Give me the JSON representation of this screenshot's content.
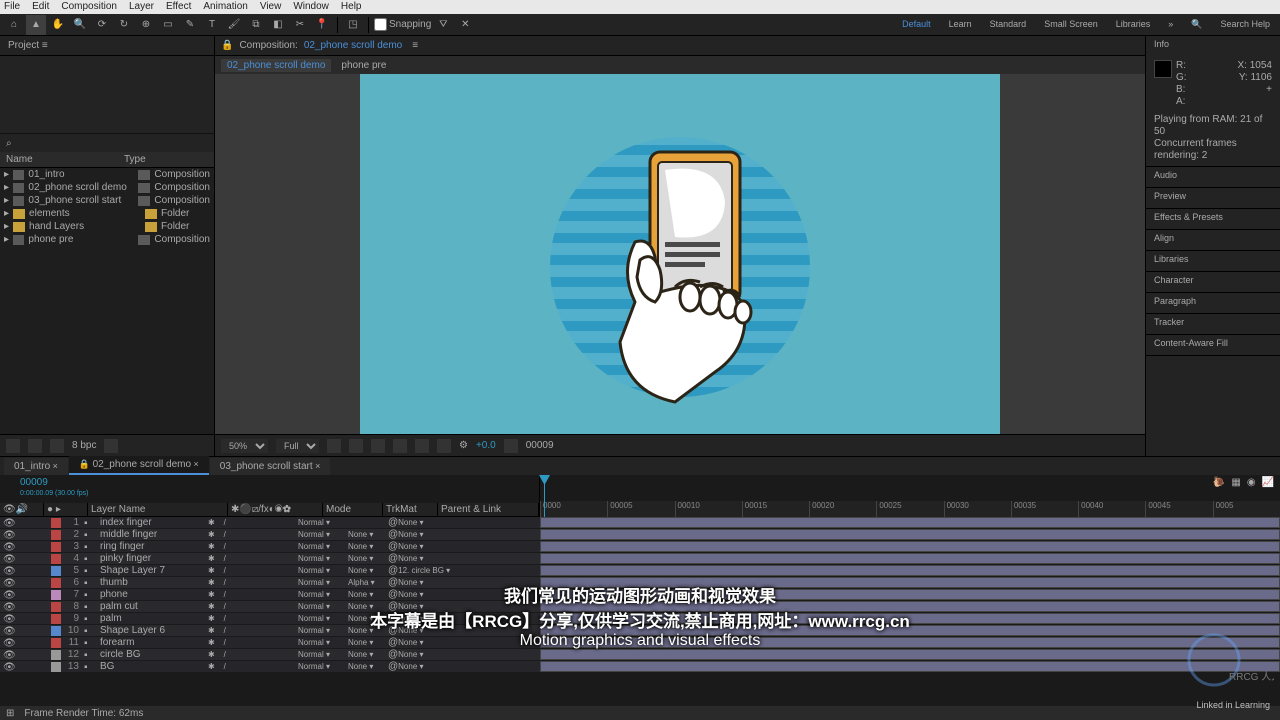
{
  "menu": [
    "File",
    "Edit",
    "Composition",
    "Layer",
    "Effect",
    "Animation",
    "View",
    "Window",
    "Help"
  ],
  "toolbar": {
    "snapping": "Snapping"
  },
  "workspaces": [
    "Default",
    "Learn",
    "Standard",
    "Small Screen",
    "Libraries"
  ],
  "search_help": "Search Help",
  "project": {
    "title": "Project",
    "search_icon": "⌕",
    "cols": {
      "name": "Name",
      "type": "Type"
    },
    "items": [
      {
        "name": "01_intro",
        "type": "Composition",
        "icon": "comp"
      },
      {
        "name": "02_phone scroll demo",
        "type": "Composition",
        "icon": "comp"
      },
      {
        "name": "03_phone scroll start",
        "type": "Composition",
        "icon": "comp"
      },
      {
        "name": "elements",
        "type": "Folder",
        "icon": "folder"
      },
      {
        "name": "hand Layers",
        "type": "Folder",
        "icon": "folder"
      },
      {
        "name": "phone pre",
        "type": "Composition",
        "icon": "comp"
      }
    ],
    "bpc": "8 bpc"
  },
  "comp": {
    "tab_label": "Composition:",
    "tab_name": "02_phone scroll demo",
    "crumbs": [
      "02_phone scroll demo",
      "phone pre"
    ]
  },
  "viewer_footer": {
    "zoom": "50%",
    "res": "Full",
    "exp_off": "+0.0",
    "frame": "00009"
  },
  "info": {
    "title": "Info",
    "rgb": {
      "r": "R:",
      "g": "G:",
      "b": "B:",
      "a": "A:"
    },
    "pos": {
      "x": "X: 1054",
      "y": "Y: 1106",
      "plus": "+"
    },
    "msg1": "Playing from RAM: 21 of 50",
    "msg2": "Concurrent frames rendering: 2"
  },
  "right_panels": [
    "Audio",
    "Preview",
    "Effects & Presets",
    "Align",
    "Libraries",
    "Character",
    "Paragraph",
    "Tracker",
    "Content-Aware Fill"
  ],
  "timeline": {
    "tabs": [
      "01_intro",
      "02_phone scroll demo",
      "03_phone scroll start"
    ],
    "active_tab": 1,
    "timecode": "00009",
    "timecode_sub": "0:00:00.09 (30.00 fps)",
    "ruler": [
      "0000",
      "00005",
      "00010",
      "00015",
      "00020",
      "00025",
      "00030",
      "00035",
      "00040",
      "00045",
      "0005"
    ],
    "col_hdr": {
      "layer": "Layer Name",
      "mode": "Mode",
      "trk": "TrkMat",
      "par": "Parent & Link"
    },
    "layers": [
      {
        "n": 1,
        "c": "#b44",
        "name": "index finger",
        "mode": "Normal",
        "trk": "",
        "par": "None"
      },
      {
        "n": 2,
        "c": "#b44",
        "name": "middle finger",
        "mode": "Normal",
        "trk": "None",
        "par": "None"
      },
      {
        "n": 3,
        "c": "#b44",
        "name": "ring finger",
        "mode": "Normal",
        "trk": "None",
        "par": "None"
      },
      {
        "n": 4,
        "c": "#b44",
        "name": "pinky finger",
        "mode": "Normal",
        "trk": "None",
        "par": "None"
      },
      {
        "n": 5,
        "c": "#58c",
        "name": "Shape Layer 7",
        "mode": "Normal",
        "trk": "None",
        "par": "12. circle BG"
      },
      {
        "n": 6,
        "c": "#b44",
        "name": "thumb",
        "mode": "Normal",
        "trk": "Alpha",
        "par": "None"
      },
      {
        "n": 7,
        "c": "#b8b",
        "name": "phone",
        "mode": "Normal",
        "trk": "None",
        "par": "None"
      },
      {
        "n": 8,
        "c": "#b44",
        "name": "palm cut",
        "mode": "Normal",
        "trk": "None",
        "par": "None"
      },
      {
        "n": 9,
        "c": "#b44",
        "name": "palm",
        "mode": "Normal",
        "trk": "None",
        "par": "None"
      },
      {
        "n": 10,
        "c": "#58c",
        "name": "Shape Layer 6",
        "mode": "Normal",
        "trk": "None",
        "par": "None"
      },
      {
        "n": 11,
        "c": "#b44",
        "name": "forearm",
        "mode": "Normal",
        "trk": "None",
        "par": "None"
      },
      {
        "n": 12,
        "c": "#999",
        "name": "circle BG",
        "mode": "Normal",
        "trk": "None",
        "par": "None"
      },
      {
        "n": 13,
        "c": "#999",
        "name": "BG",
        "mode": "Normal",
        "trk": "None",
        "par": "None"
      }
    ]
  },
  "footer": {
    "frt": "Frame Render Time: 62ms"
  },
  "subs": {
    "cn1": "我们常见的运动图形动画和视觉效果",
    "cn2": "本字幕是由【RRCG】分享,仅供学习交流,禁止商用,网址：www.rrcg.cn",
    "en": "Motion graphics and visual effects"
  },
  "watermark": "Linked in Learning",
  "logo_text": "RRCG 人人素材"
}
